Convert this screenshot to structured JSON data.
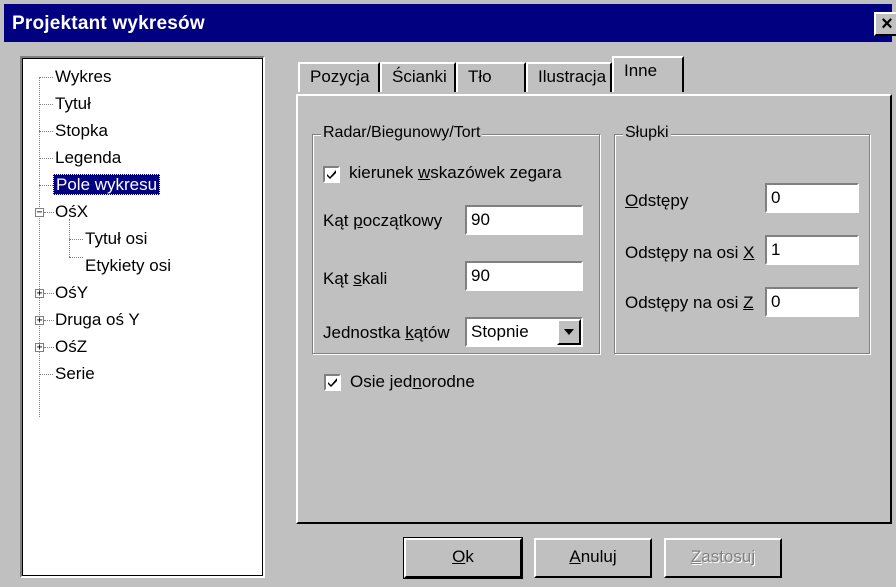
{
  "window": {
    "title": "Projektant wykresów",
    "close_glyph": "×"
  },
  "tree": {
    "items": [
      {
        "label": "Wykres"
      },
      {
        "label": "Tytuł"
      },
      {
        "label": "Stopka"
      },
      {
        "label": "Legenda"
      },
      {
        "label": "Pole wykresu",
        "selected": true
      },
      {
        "label": "OśX",
        "expander": "−"
      },
      {
        "label": "Tytuł osi"
      },
      {
        "label": "Etykiety osi"
      },
      {
        "label": "OśY",
        "expander": "+"
      },
      {
        "label": "Druga oś Y",
        "expander": "+"
      },
      {
        "label": "OśZ",
        "expander": "+"
      },
      {
        "label": "Serie"
      }
    ]
  },
  "tabs": [
    {
      "label": "Pozycja"
    },
    {
      "label": "Ścianki"
    },
    {
      "label": "Tło"
    },
    {
      "label": "Ilustracja"
    },
    {
      "label": "Inne",
      "active": true
    }
  ],
  "radar_group": {
    "title": "Radar/Biegunowy/Tort",
    "clockwise": {
      "label_pre": "kierunek ",
      "label_u": "w",
      "label_post": "skazówek zegara",
      "checked": true
    },
    "start_angle": {
      "label_pre": "Kąt ",
      "label_u": "p",
      "label_post": "oczątkowy",
      "value": "90"
    },
    "scale_angle": {
      "label_pre": "Kąt ",
      "label_u": "s",
      "label_post": "kali",
      "value": "90"
    },
    "angle_unit": {
      "label_pre": "Jednostka ",
      "label_u": "k",
      "label_post": "ątów",
      "value": "Stopnie"
    }
  },
  "bars_group": {
    "title": "Słupki",
    "spacing": {
      "label_pre": "",
      "label_u": "O",
      "label_post": "dstępy",
      "value": "0"
    },
    "spacing_x": {
      "label_pre": "Odstępy na osi ",
      "label_u": "X",
      "label_post": "",
      "value": "1"
    },
    "spacing_z": {
      "label_pre": "Odstępy na osi ",
      "label_u": "Z",
      "label_post": "",
      "value": "0"
    }
  },
  "uniform_axes": {
    "label_pre": "Osie jed",
    "label_u": "n",
    "label_post": "orodne",
    "checked": true
  },
  "buttons": {
    "ok": {
      "u": "O",
      "rest": "k"
    },
    "cancel": {
      "u": "A",
      "rest": "nuluj"
    },
    "apply": {
      "u": "Z",
      "rest": "astosuj"
    }
  }
}
